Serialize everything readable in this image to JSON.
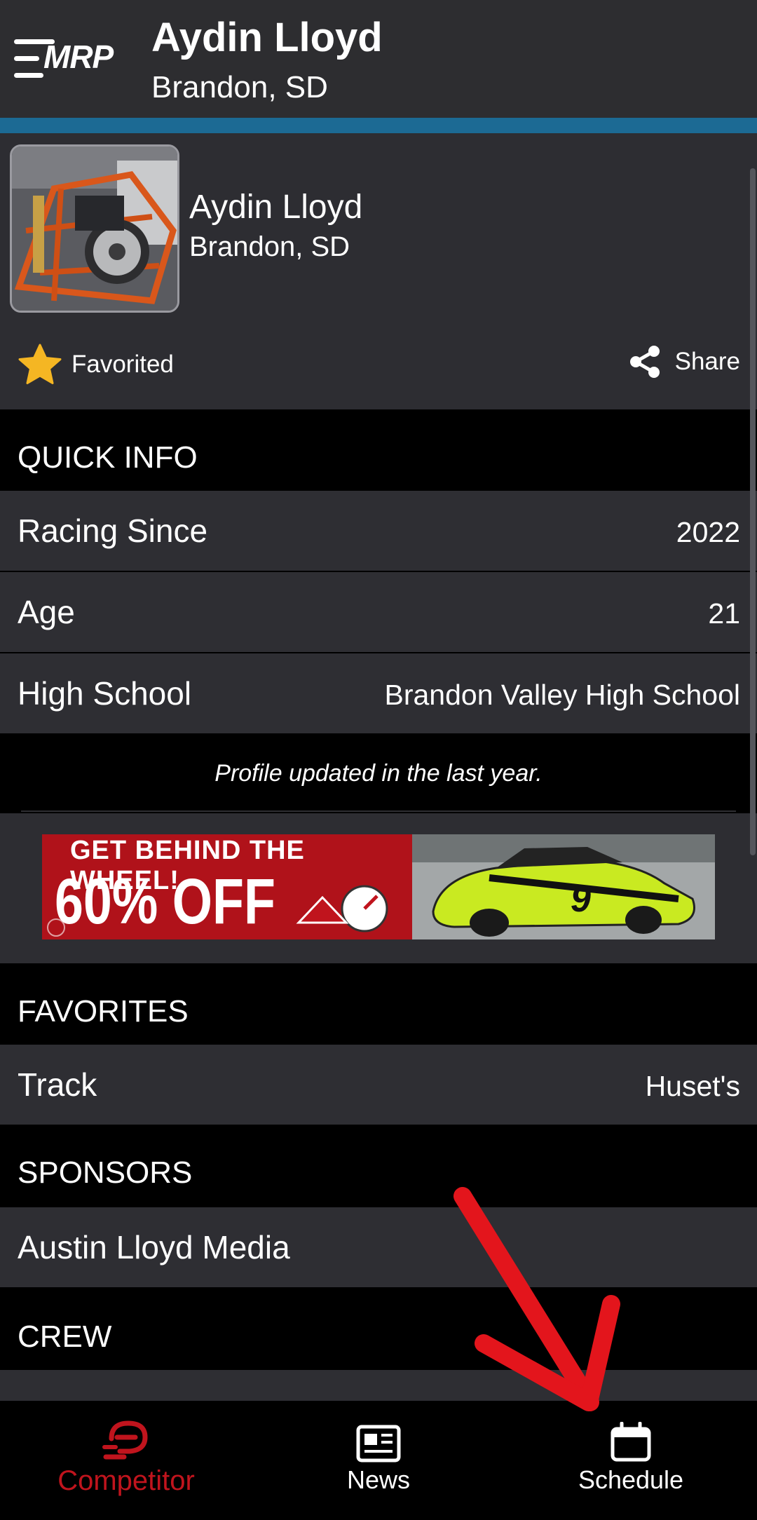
{
  "header": {
    "title": "Aydin Lloyd",
    "subtitle": "Brandon, SD",
    "logo_text": "MRP"
  },
  "profile": {
    "name": "Aydin Lloyd",
    "location": "Brandon, SD",
    "favorite_label": "Favorited",
    "share_label": "Share"
  },
  "quick_info": {
    "heading": "QUICK INFO",
    "rows": [
      {
        "label": "Racing Since",
        "value": "2022"
      },
      {
        "label": "Age",
        "value": "21"
      },
      {
        "label": "High School",
        "value": "Brandon Valley High School"
      }
    ],
    "updated_note": "Profile updated in the last year."
  },
  "ad": {
    "line1": "GET BEHIND THE WHEEL!",
    "line2": "60% OFF",
    "car_number": "9"
  },
  "favorites": {
    "heading": "FAVORITES",
    "rows": [
      {
        "label": "Track",
        "value": "Huset's"
      }
    ]
  },
  "sponsors": {
    "heading": "SPONSORS",
    "rows": [
      {
        "label": "Austin Lloyd Media"
      }
    ]
  },
  "crew": {
    "heading": "CREW"
  },
  "bottom_nav": {
    "items": [
      {
        "label": "Competitor",
        "icon": "competitor-icon",
        "active": true
      },
      {
        "label": "News",
        "icon": "newspaper-icon",
        "active": false
      },
      {
        "label": "Schedule",
        "icon": "calendar-icon",
        "active": false
      }
    ]
  },
  "colors": {
    "header_bg": "#2d2d30",
    "accent_bar": "#1c6a94",
    "row_bg": "#2e2e33",
    "section_bg": "#000000",
    "star": "#f5b623",
    "active_nav": "#c0141d",
    "annotation_arrow": "#e3151c"
  }
}
